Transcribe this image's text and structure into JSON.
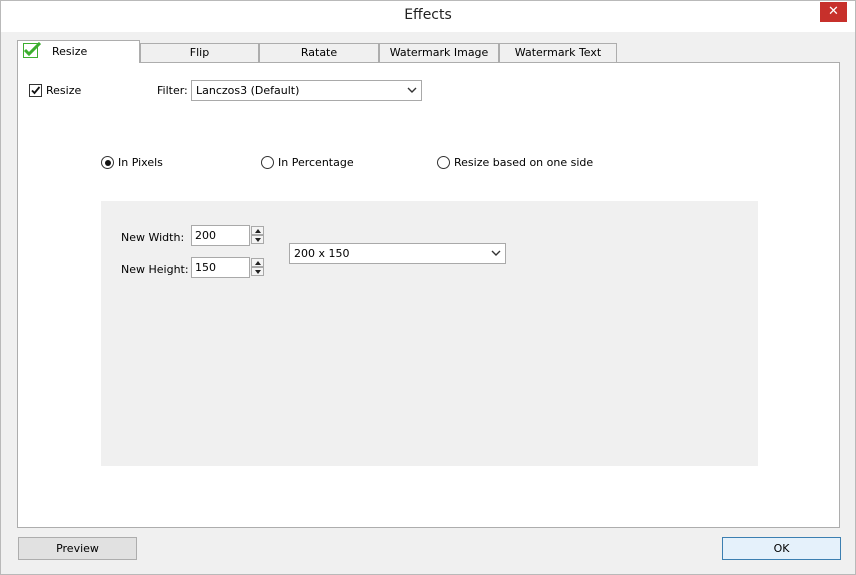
{
  "window": {
    "title": "Effects",
    "close_glyph": "✕"
  },
  "tabs": [
    {
      "label": "Resize",
      "icon": "check-icon",
      "active": true
    },
    {
      "label": "Flip"
    },
    {
      "label": "Ratate"
    },
    {
      "label": "Watermark Image"
    },
    {
      "label": "Watermark Text"
    }
  ],
  "resize": {
    "enable_label": "Resize",
    "enabled": true,
    "filter_label": "Filter:",
    "filter_value": "Lanczos3 (Default)",
    "modes": [
      {
        "label": "In Pixels",
        "selected": true
      },
      {
        "label": "In Percentage",
        "selected": false
      },
      {
        "label": "Resize based on one side",
        "selected": false
      }
    ],
    "width_label": "New Width:",
    "width_value": "200",
    "height_label": "New Height:",
    "height_value": "150",
    "preset_value": "200 x 150"
  },
  "buttons": {
    "preview": "Preview",
    "ok": "OK"
  },
  "colors": {
    "close_red": "#c7302b",
    "check_green": "#3cae2f",
    "ok_border": "#3c7fb1"
  }
}
